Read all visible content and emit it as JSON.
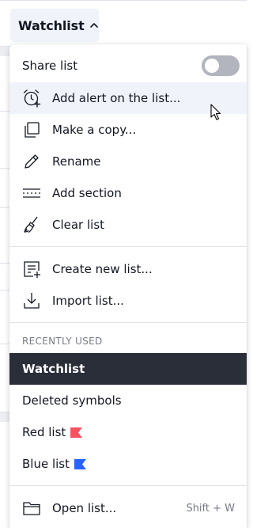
{
  "header": {
    "title": "Watchlist"
  },
  "menu": {
    "share_list": {
      "label": "Share list",
      "enabled": false
    },
    "actions": [
      {
        "label": "Add alert on the list...",
        "icon": "alarm-clock-plus-icon"
      },
      {
        "label": "Make a copy...",
        "icon": "copy-icon"
      },
      {
        "label": "Rename",
        "icon": "pencil-icon"
      },
      {
        "label": "Add section",
        "icon": "add-section-icon"
      },
      {
        "label": "Clear list",
        "icon": "broom-icon"
      }
    ],
    "list_actions": [
      {
        "label": "Create new list...",
        "icon": "new-list-icon"
      },
      {
        "label": "Import list...",
        "icon": "import-icon"
      }
    ],
    "recently_used_title": "RECENTLY USED",
    "recent_lists": [
      {
        "label": "Watchlist",
        "active": true
      },
      {
        "label": "Deleted symbols"
      },
      {
        "label": "Red list",
        "flag_color": "#f7525f"
      },
      {
        "label": "Blue list",
        "flag_color": "#2962ff"
      }
    ],
    "open_list": {
      "label": "Open list...",
      "shortcut": "Shift + W",
      "icon": "folder-icon"
    }
  },
  "colors": {
    "active_bg": "#2a2e39",
    "hover_bg": "#f0f3fa",
    "toggle_off": "#b2b5be",
    "red_flag": "#f7525f",
    "blue_flag": "#2962ff"
  }
}
